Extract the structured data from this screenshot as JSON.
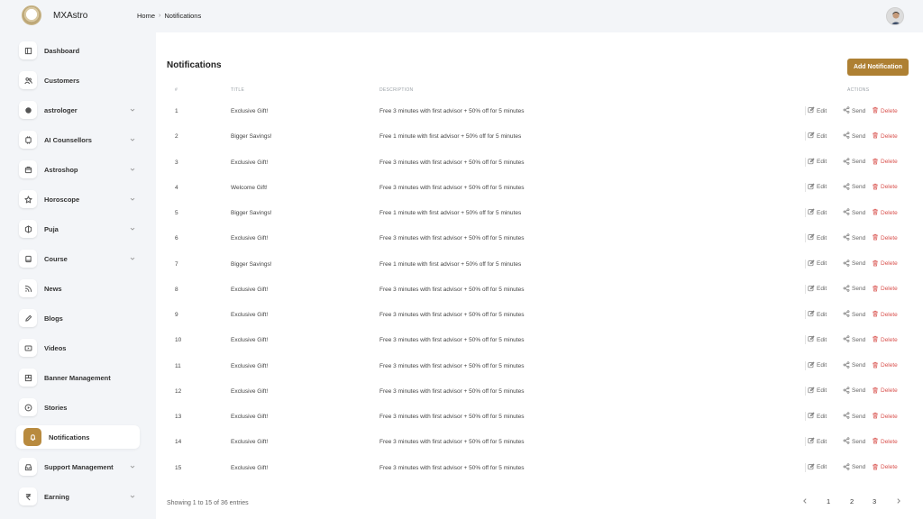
{
  "app": {
    "brand": "MXAstro"
  },
  "breadcrumb": {
    "home": "Home",
    "separator": "›",
    "current": "Notifications"
  },
  "sidebar": {
    "items": [
      {
        "label": "Dashboard",
        "icon": "dashboard-icon",
        "expandable": false
      },
      {
        "label": "Customers",
        "icon": "users-icon",
        "expandable": false
      },
      {
        "label": "astrologer",
        "icon": "astrologer-icon",
        "expandable": true
      },
      {
        "label": "AI Counsellors",
        "icon": "ai-icon",
        "expandable": true
      },
      {
        "label": "Astroshop",
        "icon": "shop-icon",
        "expandable": true
      },
      {
        "label": "Horoscope",
        "icon": "star-icon",
        "expandable": true
      },
      {
        "label": "Puja",
        "icon": "puja-icon",
        "expandable": true
      },
      {
        "label": "Course",
        "icon": "book-icon",
        "expandable": true
      },
      {
        "label": "News",
        "icon": "rss-icon",
        "expandable": false
      },
      {
        "label": "Blogs",
        "icon": "pen-icon",
        "expandable": false
      },
      {
        "label": "Videos",
        "icon": "video-icon",
        "expandable": false
      },
      {
        "label": "Banner Management",
        "icon": "banner-icon",
        "expandable": false
      },
      {
        "label": "Stories",
        "icon": "play-icon",
        "expandable": false
      },
      {
        "label": "Notifications",
        "icon": "bell-icon",
        "expandable": false,
        "active": true
      },
      {
        "label": "Support Management",
        "icon": "inbox-icon",
        "expandable": true
      },
      {
        "label": "Earning",
        "icon": "rupee-icon",
        "expandable": true
      }
    ]
  },
  "main": {
    "title": "Notifications",
    "add_button": "Add Notification",
    "columns": {
      "num": "#",
      "title": "TITLE",
      "description": "DESCRIPTION",
      "actions": "ACTIONS"
    },
    "actions": {
      "edit": "Edit",
      "send": "Send",
      "delete": "Delete"
    },
    "rows": [
      {
        "num": "1",
        "title": "Exclusive Gift!",
        "description": "Free 3 minutes with first advisor + 50% off for 5 minutes"
      },
      {
        "num": "2",
        "title": "Bigger Savings!",
        "description": "Free 1 minute with first advisor + 50% off for 5 minutes"
      },
      {
        "num": "3",
        "title": "Exclusive Gift!",
        "description": "Free 3 minutes with first advisor + 50% off for 5 minutes"
      },
      {
        "num": "4",
        "title": "Welcome Gift!",
        "description": "Free 3 minutes with first advisor + 50% off for 5 minutes"
      },
      {
        "num": "5",
        "title": "Bigger Savings!",
        "description": "Free 1 minute with first advisor + 50% off for 5 minutes"
      },
      {
        "num": "6",
        "title": "Exclusive Gift!",
        "description": "Free 3 minutes with first advisor + 50% off for 5 minutes"
      },
      {
        "num": "7",
        "title": "Bigger Savings!",
        "description": "Free 1 minute with first advisor + 50% off for 5 minutes"
      },
      {
        "num": "8",
        "title": "Exclusive Gift!",
        "description": "Free 3 minutes with first advisor + 50% off for 5 minutes"
      },
      {
        "num": "9",
        "title": "Exclusive Gift!",
        "description": "Free 3 minutes with first advisor + 50% off for 5 minutes"
      },
      {
        "num": "10",
        "title": "Exclusive Gift!",
        "description": "Free 3 minutes with first advisor + 50% off for 5 minutes"
      },
      {
        "num": "11",
        "title": "Exclusive Gift!",
        "description": "Free 3 minutes with first advisor + 50% off for 5 minutes"
      },
      {
        "num": "12",
        "title": "Exclusive Gift!",
        "description": "Free 3 minutes with first advisor + 50% off for 5 minutes"
      },
      {
        "num": "13",
        "title": "Exclusive Gift!",
        "description": "Free 3 minutes with first advisor + 50% off for 5 minutes"
      },
      {
        "num": "14",
        "title": "Exclusive Gift!",
        "description": "Free 3 minutes with first advisor + 50% off for 5 minutes"
      },
      {
        "num": "15",
        "title": "Exclusive Gift!",
        "description": "Free 3 minutes with first advisor + 50% off for 5 minutes"
      }
    ],
    "footer": {
      "showing": "Showing 1 to 15 of 36 entries"
    },
    "pagination": {
      "pages": [
        "1",
        "2",
        "3"
      ],
      "current": "1"
    }
  },
  "colors": {
    "accent": "#ae8033",
    "delete": "#d9534f",
    "background": "#f3f5f8"
  }
}
